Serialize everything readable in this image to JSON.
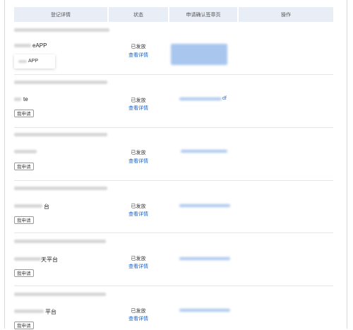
{
  "table": {
    "headers": [
      "登记详情",
      "状态",
      "申请确认签章页",
      "操作"
    ]
  },
  "rows": [
    {
      "name_suffix": "eAPP",
      "status": "已发放",
      "detail_link": "查看详情",
      "button": "",
      "link_suffix": ""
    },
    {
      "name_suffix": "te",
      "status": "已发放",
      "detail_link": "查看详情",
      "button": "我申请",
      "link_suffix": "df"
    },
    {
      "name_suffix": "",
      "status": "已发放",
      "detail_link": "查看详情",
      "button": "我申请",
      "link_suffix": ""
    },
    {
      "name_suffix": "台",
      "status": "已发放",
      "detail_link": "查看详情",
      "button": "我申请",
      "link_suffix": ""
    },
    {
      "name_suffix": "天平台",
      "status": "已发放",
      "detail_link": "查看详情",
      "button": "我申请",
      "link_suffix": ""
    },
    {
      "name_suffix": "平台",
      "status": "已发放",
      "detail_link": "查看详情",
      "button": "我申请",
      "link_suffix": ""
    }
  ],
  "popup": {
    "text": "APP"
  }
}
